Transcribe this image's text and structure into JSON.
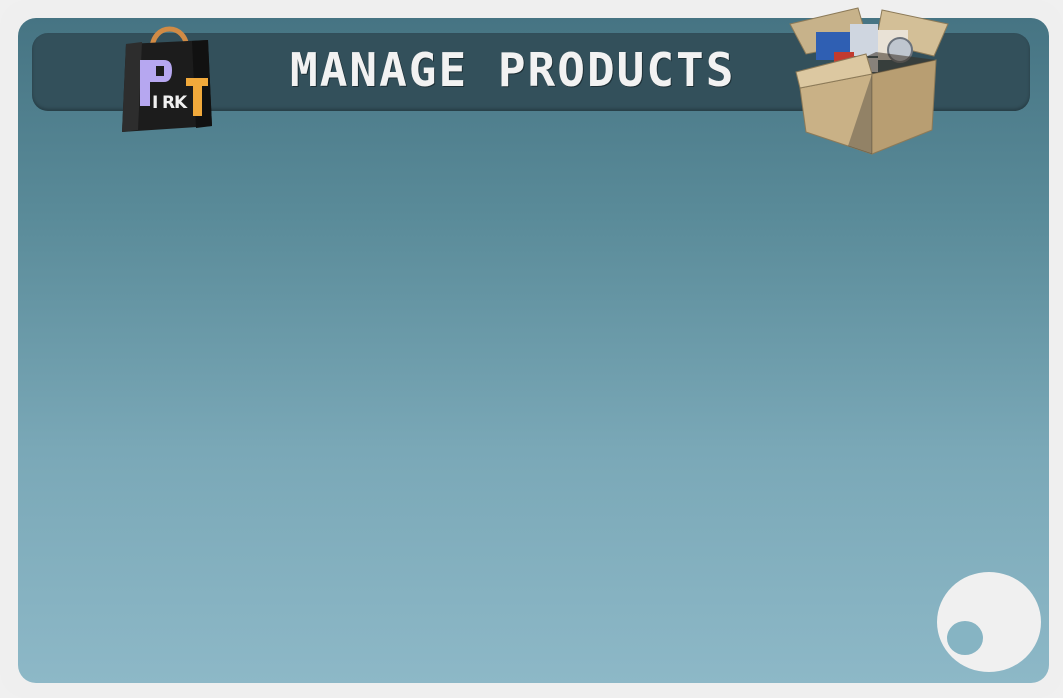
{
  "header": {
    "title": "MANAGE PRODUCTS"
  },
  "logo": {
    "letters": [
      "P",
      "I",
      "R",
      "K",
      "T"
    ],
    "icon": "shopping-bag-icon"
  },
  "header_icon": {
    "icon": "cardboard-box-icon"
  },
  "footer_button": {
    "icon": "round-button-icon"
  },
  "colors": {
    "panel_top": "#467483",
    "panel_bottom": "#8db8c7",
    "header_bar": "#33505b",
    "frame": "#efefef",
    "logo_lavender": "#b6a7f0",
    "logo_orange": "#f1a93b"
  }
}
